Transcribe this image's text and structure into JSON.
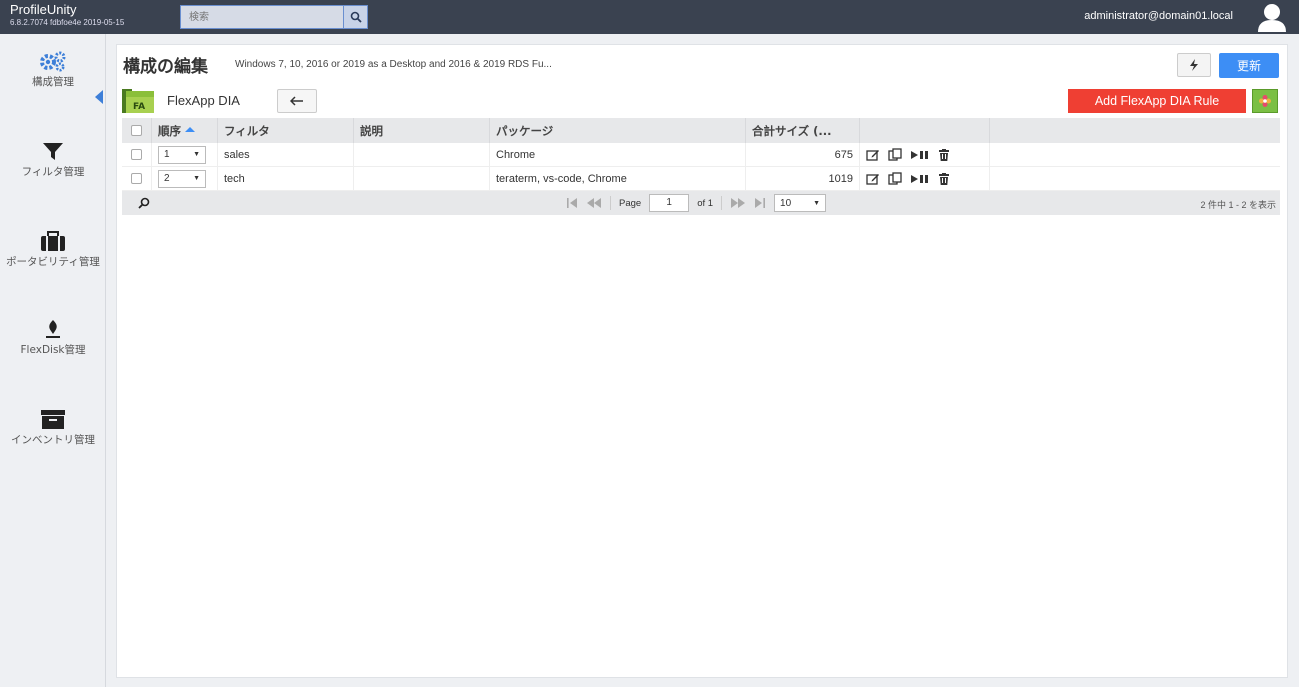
{
  "app": {
    "name": "ProfileUnity",
    "version": "6.8.2.7074 fdbfoe4e 2019-05-15"
  },
  "search": {
    "placeholder": "検索"
  },
  "user": {
    "email": "administrator@domain01.local"
  },
  "sidebar": {
    "items": [
      {
        "label": "構成管理",
        "icon": "gears-icon",
        "active": true
      },
      {
        "label": "フィルタ管理",
        "icon": "filter-icon"
      },
      {
        "label": "ポータビリティ管理",
        "icon": "briefcase-icon"
      },
      {
        "label": "FlexDisk管理",
        "icon": "flexdisk-icon"
      },
      {
        "label": "インベントリ管理",
        "icon": "archive-icon"
      }
    ]
  },
  "header": {
    "title": "構成の編集",
    "subtitle": "Windows 7, 10, 2016 or 2019 as a Desktop and 2016 & 2019 RDS Fu...",
    "refresh_label": "更新"
  },
  "section": {
    "icon_text": "FA",
    "label": "FlexApp DIA",
    "add_label": "Add FlexApp DIA Rule"
  },
  "grid": {
    "columns": [
      "順序",
      "フィルタ",
      "説明",
      "パッケージ",
      "合計サイズ (..."
    ],
    "rows": [
      {
        "order": "1",
        "filter": "sales",
        "description": "",
        "packages": "Chrome",
        "size": "675"
      },
      {
        "order": "2",
        "filter": "tech",
        "description": "",
        "packages": "teraterm, vs-code, Chrome",
        "size": "1019"
      }
    ]
  },
  "pager": {
    "page_label": "Page",
    "page": "1",
    "of_label": "of 1",
    "page_size": "10",
    "info": "2 件中 1 - 2 を表示"
  },
  "colors": {
    "topbar": "#3a4250",
    "accent": "#3d8ef5",
    "danger": "#ef3f33"
  }
}
